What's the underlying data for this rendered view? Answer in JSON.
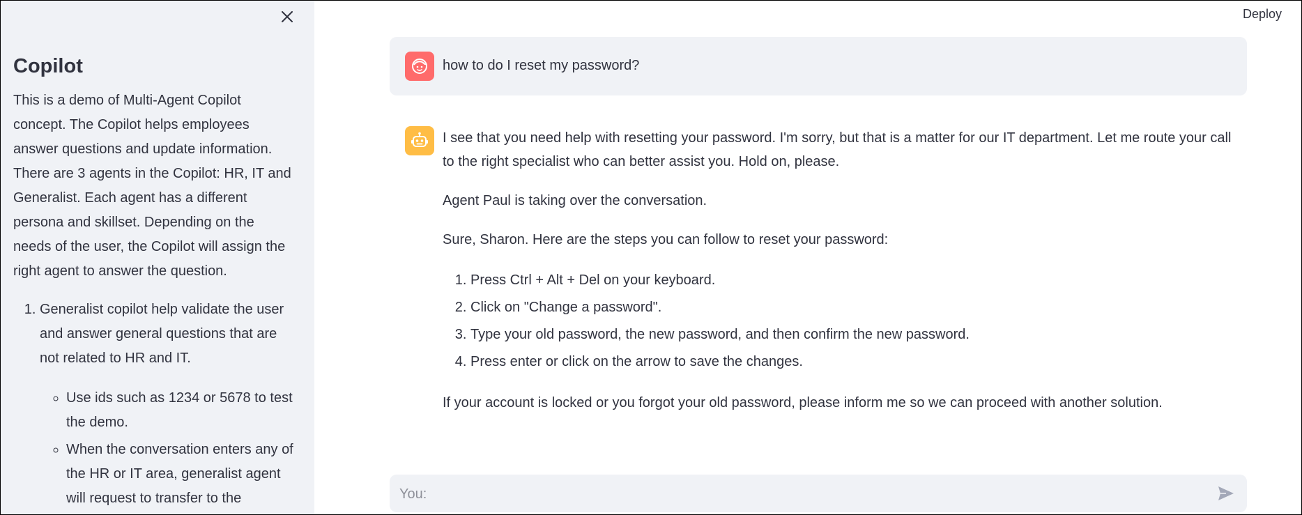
{
  "sidebar": {
    "title": "Copilot",
    "description": "This is a demo of Multi-Agent Copilot concept. The Copilot helps employees answer questions and update information. There are 3 agents in the Copilot: HR, IT and Generalist. Each agent has a different persona and skillset. Depending on the needs of the user, the Copilot will assign the right agent to answer the question.",
    "list": [
      {
        "text": "Generalist copilot help validate the user and answer general questions that are not related to HR and IT.",
        "subitems": [
          "Use ids such as 1234 or 5678 to test the demo.",
          "When the conversation enters any of the HR or IT area, generalist agent will request to transfer to the"
        ]
      }
    ],
    "close_icon": "close-icon"
  },
  "header": {
    "deploy_label": "Deploy"
  },
  "chat": {
    "user_message": "how to do I reset my password?",
    "user_avatar_icon": "user-face-icon",
    "bot_avatar_icon": "robot-icon",
    "assistant": {
      "paragraph1": "I see that you need help with resetting your password. I'm sorry, but that is a matter for our IT department. Let me route your call to the right specialist who can better assist you. Hold on, please.",
      "paragraph2": "Agent Paul is taking over the conversation.",
      "paragraph3": "Sure, Sharon. Here are the steps you can follow to reset your password:",
      "steps": [
        "Press Ctrl + Alt + Del on your keyboard.",
        "Click on \"Change a password\".",
        "Type your old password, the new password, and then confirm the new password.",
        "Press enter or click on the arrow to save the changes."
      ],
      "paragraph4": "If your account is locked or you forgot your old password, please inform me so we can proceed with another solution."
    },
    "input": {
      "placeholder": "You:",
      "value": "",
      "send_icon": "send-icon"
    }
  },
  "colors": {
    "sidebar_bg": "#f0f2f6",
    "user_avatar": "#ff6b6b",
    "bot_avatar": "#ffbd45",
    "text": "#31333f"
  }
}
